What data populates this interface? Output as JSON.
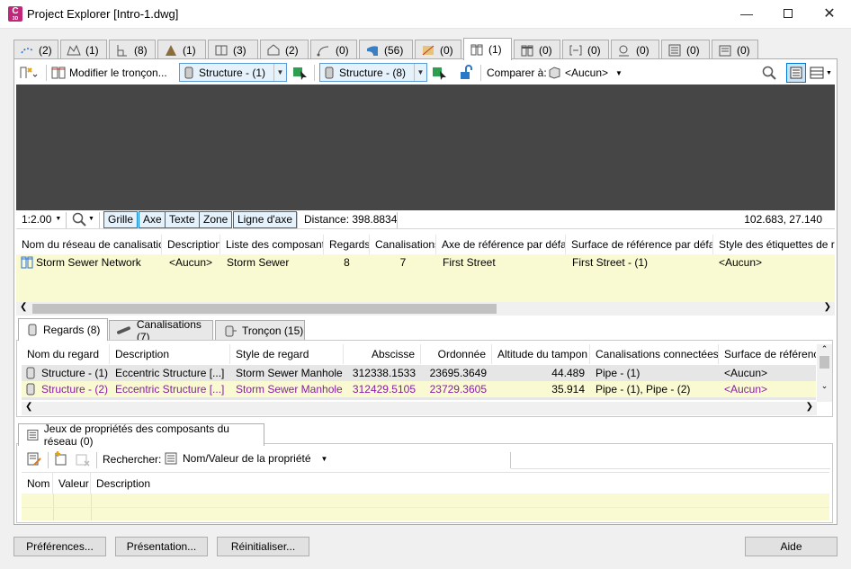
{
  "window": {
    "title": "Project Explorer [Intro-1.dwg]",
    "app_icon_letter": "C",
    "app_icon_sub": "3D"
  },
  "tabs": [
    {
      "icon": "dashed-alignment-icon",
      "count": "(2)"
    },
    {
      "icon": "profile-view-icon",
      "count": "(1)"
    },
    {
      "icon": "profile-icon",
      "count": "(8)"
    },
    {
      "icon": "corridor-icon",
      "count": "(1)"
    },
    {
      "icon": "assembly-icon",
      "count": "(3)"
    },
    {
      "icon": "parcel-icon",
      "count": "(2)"
    },
    {
      "icon": "feature-line-icon",
      "count": "(0)"
    },
    {
      "icon": "surface-icon",
      "count": "(56)"
    },
    {
      "icon": "point-group-icon",
      "count": "(0)"
    },
    {
      "icon": "pipe-network-icon",
      "count": "(1)"
    },
    {
      "icon": "pressure-network-icon",
      "count": "(0)"
    },
    {
      "icon": "section-view-icon",
      "count": "(0)"
    },
    {
      "icon": "sample-line-icon",
      "count": "(0)"
    },
    {
      "icon": "table-icon",
      "count": "(0)"
    },
    {
      "icon": "report-icon",
      "count": "(0)"
    }
  ],
  "toolbar": {
    "modify_label": "Modifier le tronçon...",
    "structure_start": "Structure - (1)",
    "structure_end": "Structure - (8)",
    "compare_label": "Comparer à:",
    "compare_value": "<Aucun>"
  },
  "viewstatus": {
    "scale": "1:2.00",
    "buttons": [
      "Grille",
      "Axe",
      "Texte",
      "Zone",
      "Ligne d'axe"
    ],
    "distance": "Distance: 398.8834",
    "coords": "102.683, 27.140"
  },
  "network_grid": {
    "headers": [
      "Nom du réseau de canalisations",
      "Description",
      "Liste des composants",
      "Regards",
      "Canalisations",
      "Axe de référence par défaut",
      "Surface de référence par défaut",
      "Style des étiquettes de regards"
    ],
    "rows": [
      [
        "Storm Sewer Network",
        "<Aucun>",
        "Storm Sewer",
        "8",
        "7",
        "First Street",
        "First Street - (1)",
        "<Aucun>"
      ]
    ]
  },
  "sub_tabs": [
    {
      "label": "Regards (8)",
      "icon": "manhole-icon"
    },
    {
      "label": "Canalisations (7)",
      "icon": "pipe-icon"
    },
    {
      "label": "Tronçon (15)",
      "icon": "run-icon"
    }
  ],
  "structures_grid": {
    "headers": [
      "Nom du regard",
      "Description",
      "Style de regard",
      "Abscisse",
      "Ordonnée",
      "Altitude du tampon",
      "Canalisations connectées",
      "Surface de référence"
    ],
    "rows": [
      [
        "Structure - (1)",
        "Eccentric Structure  [...]",
        "Storm Sewer Manhole",
        "312338.1533",
        "23695.3649",
        "44.489",
        "Pipe - (1)",
        "<Aucun>"
      ],
      [
        "Structure - (2)",
        "Eccentric Structure  [...]",
        "Storm Sewer Manhole",
        "312429.5105",
        "23729.3605",
        "35.914",
        "Pipe - (1), Pipe - (2)",
        "<Aucun>"
      ]
    ]
  },
  "props_panel": {
    "tab_label": "Jeux de propriétés des composants du réseau (0)",
    "search_label": "Rechercher:",
    "search_mode": "Nom/Valeur de la propriété",
    "headers": [
      "Nom",
      "Valeur",
      "Description"
    ]
  },
  "footer": {
    "preferences": "Préférences...",
    "presentation": "Présentation...",
    "reset": "Réinitialiser...",
    "help": "Aide"
  },
  "colors": {
    "accent": "#0078d7",
    "highlight_row": "#fafad2",
    "viewport": "#464646",
    "purple_text": "#8a1aa8"
  }
}
